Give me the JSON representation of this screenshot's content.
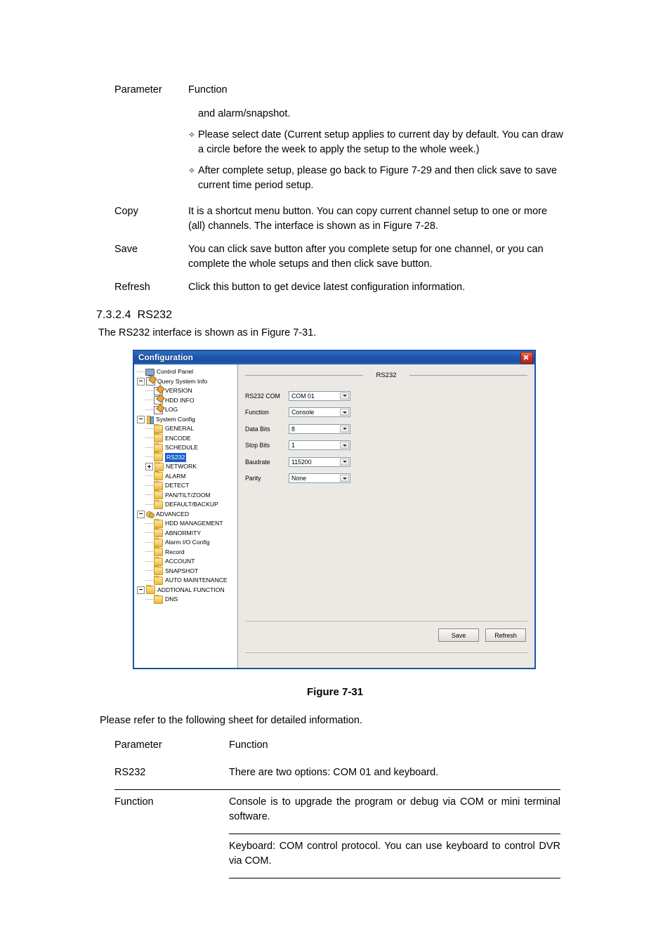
{
  "top_table": {
    "header": {
      "parameter": "Parameter",
      "function": "Function"
    },
    "continued_text": "and alarm/snapshot.",
    "bullets": [
      "Please select date (Current setup applies to current day by default. You can draw a circle before the week to apply the setup to the whole week.)",
      "After complete setup, please go back to Figure 7-29 and then click save to save current time period setup."
    ],
    "bullet_glyph": "✧",
    "rows": [
      {
        "parameter": "Copy",
        "function": "It is a shortcut menu button. You can copy current channel setup to one or more (all) channels.    The interface is shown as in Figure 7-28."
      },
      {
        "parameter": "Save",
        "function": "You can click save button after you complete setup for one channel, or you can complete the whole setups and then click save button."
      },
      {
        "parameter": "Refresh",
        "function": "Click this button to get device latest configuration information."
      }
    ]
  },
  "section": {
    "number": "7.3.2.4",
    "title": "RS232",
    "intro": "The RS232 interface is shown as in Figure 7-31."
  },
  "dialog": {
    "title": "Configuration",
    "close_icon": "close-icon",
    "group_title": "RS232",
    "tree": [
      {
        "label": "Control Panel",
        "depth": 0,
        "icon": "monitor",
        "expander": "none",
        "connector": false,
        "selected": false
      },
      {
        "label": "Query System Info",
        "depth": 0,
        "icon": "note",
        "expander": "minus",
        "connector": true,
        "selected": false
      },
      {
        "label": "VERSION",
        "depth": 1,
        "icon": "note",
        "expander": "none",
        "connector": true,
        "selected": false
      },
      {
        "label": "HDD INFO",
        "depth": 1,
        "icon": "note",
        "expander": "none",
        "connector": true,
        "selected": false
      },
      {
        "label": "LOG",
        "depth": 1,
        "icon": "note",
        "expander": "none",
        "connector": true,
        "selected": false
      },
      {
        "label": "System Config",
        "depth": 0,
        "icon": "tools",
        "expander": "minus",
        "connector": true,
        "selected": false
      },
      {
        "label": "GENERAL",
        "depth": 1,
        "icon": "folder",
        "expander": "none",
        "connector": true,
        "selected": false
      },
      {
        "label": "ENCODE",
        "depth": 1,
        "icon": "folder",
        "expander": "none",
        "connector": true,
        "selected": false
      },
      {
        "label": "SCHEDULE",
        "depth": 1,
        "icon": "folder",
        "expander": "none",
        "connector": true,
        "selected": false
      },
      {
        "label": "RS232",
        "depth": 1,
        "icon": "folder",
        "expander": "none",
        "connector": true,
        "selected": true
      },
      {
        "label": "NETWORK",
        "depth": 1,
        "icon": "folder",
        "expander": "plus",
        "connector": false,
        "selected": false
      },
      {
        "label": "ALARM",
        "depth": 1,
        "icon": "folder",
        "expander": "none",
        "connector": true,
        "selected": false
      },
      {
        "label": "DETECT",
        "depth": 1,
        "icon": "folder",
        "expander": "none",
        "connector": true,
        "selected": false
      },
      {
        "label": "PAN/TILT/ZOOM",
        "depth": 1,
        "icon": "folder",
        "expander": "none",
        "connector": true,
        "selected": false
      },
      {
        "label": "DEFAULT/BACKUP",
        "depth": 1,
        "icon": "folder",
        "expander": "none",
        "connector": true,
        "selected": false
      },
      {
        "label": "ADVANCED",
        "depth": 0,
        "icon": "gears",
        "expander": "minus",
        "connector": true,
        "selected": false
      },
      {
        "label": "HDD MANAGEMENT",
        "depth": 1,
        "icon": "folder",
        "expander": "none",
        "connector": true,
        "selected": false
      },
      {
        "label": "ABNORMITY",
        "depth": 1,
        "icon": "folder",
        "expander": "none",
        "connector": true,
        "selected": false
      },
      {
        "label": "Alarm I/O Config",
        "depth": 1,
        "icon": "folder",
        "expander": "none",
        "connector": true,
        "selected": false
      },
      {
        "label": "Record",
        "depth": 1,
        "icon": "folder",
        "expander": "none",
        "connector": true,
        "selected": false
      },
      {
        "label": "ACCOUNT",
        "depth": 1,
        "icon": "folder",
        "expander": "none",
        "connector": true,
        "selected": false
      },
      {
        "label": "SNAPSHOT",
        "depth": 1,
        "icon": "folder",
        "expander": "none",
        "connector": true,
        "selected": false
      },
      {
        "label": "AUTO MAINTENANCE",
        "depth": 1,
        "icon": "folder",
        "expander": "none",
        "connector": true,
        "selected": false
      },
      {
        "label": "ADDTIONAL FUNCTION",
        "depth": 0,
        "icon": "folder",
        "expander": "minus",
        "connector": true,
        "selected": false
      },
      {
        "label": "DNS",
        "depth": 1,
        "icon": "folder",
        "expander": "none",
        "connector": true,
        "selected": false
      }
    ],
    "fields": [
      {
        "label": "RS232 COM",
        "value": "COM 01"
      },
      {
        "label": "Function",
        "value": "Console"
      },
      {
        "label": "Data Bits",
        "value": "8"
      },
      {
        "label": "Stop Bits",
        "value": "1"
      },
      {
        "label": "Baudrate",
        "value": "115200"
      },
      {
        "label": "Parity",
        "value": "None"
      }
    ],
    "buttons": {
      "save": "Save",
      "refresh": "Refresh"
    }
  },
  "figure_caption": "Figure 7-31",
  "refer_line": "Please refer to the following sheet for detailed information.",
  "bottom_table": {
    "header": {
      "parameter": "Parameter",
      "function": "Function"
    },
    "rows": [
      {
        "parameter": "RS232",
        "function": "There are two options: COM 01 and keyboard."
      },
      {
        "parameter": "Function",
        "function": "Console is to upgrade the program or debug via COM or mini terminal software.",
        "function_extra": "Keyboard: COM control protocol. You can use keyboard to control DVR via COM."
      }
    ]
  }
}
